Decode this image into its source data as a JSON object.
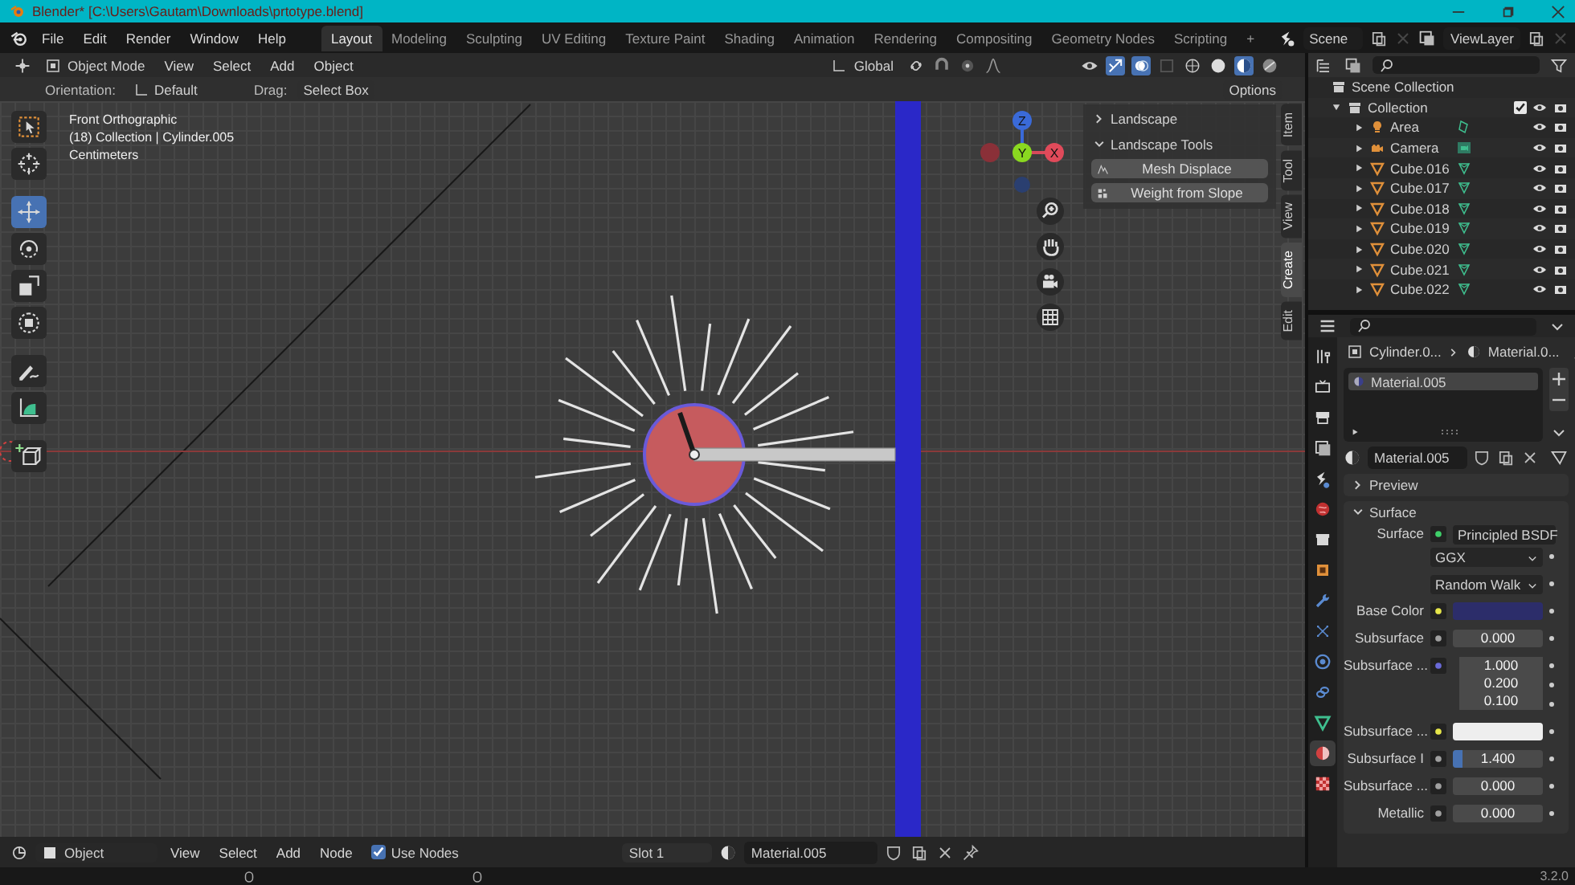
{
  "window": {
    "title": "Blender* [C:\\Users\\Gautam\\Downloads\\prtotype.blend]"
  },
  "menu": [
    "File",
    "Edit",
    "Render",
    "Window",
    "Help"
  ],
  "workspaces": [
    {
      "label": "Layout",
      "selected": true
    },
    {
      "label": "Modeling",
      "selected": false
    },
    {
      "label": "Sculpting",
      "selected": false
    },
    {
      "label": "UV Editing",
      "selected": false
    },
    {
      "label": "Texture Paint",
      "selected": false
    },
    {
      "label": "Shading",
      "selected": false
    },
    {
      "label": "Animation",
      "selected": false
    },
    {
      "label": "Rendering",
      "selected": false
    },
    {
      "label": "Compositing",
      "selected": false
    },
    {
      "label": "Geometry Nodes",
      "selected": false
    },
    {
      "label": "Scripting",
      "selected": false
    }
  ],
  "add_workspace": "+",
  "scene": "Scene",
  "view_layer": "ViewLayer",
  "viewport_header": {
    "mode": "Object Mode",
    "menus": [
      "View",
      "Select",
      "Add",
      "Object"
    ],
    "transform_orientation": "Global"
  },
  "tool_settings": {
    "orientation_label": "Orientation:",
    "orientation": "Default",
    "drag_label": "Drag:",
    "drag": "Select Box",
    "options": "Options"
  },
  "viewport_info": [
    "Front Orthographic",
    "(18) Collection | Cylinder.005",
    "Centimeters"
  ],
  "toolbar": [
    {
      "kind": "select",
      "selected": false
    },
    {
      "kind": "cursor",
      "selected": false
    },
    {
      "kind": "move",
      "selected": true
    },
    {
      "kind": "rotate",
      "selected": false
    },
    {
      "kind": "scale",
      "selected": false
    },
    {
      "kind": "transform",
      "selected": false
    },
    {
      "kind": "annotate",
      "selected": false
    },
    {
      "kind": "measure",
      "selected": false
    },
    {
      "kind": "add_cube",
      "selected": false
    }
  ],
  "gizmo_axes": [
    "Z",
    "Y",
    "X"
  ],
  "n_panel": {
    "sections": [
      {
        "label": "Landscape",
        "expanded": false
      },
      {
        "label": "Landscape Tools",
        "expanded": true
      }
    ],
    "buttons": [
      "Mesh Displace",
      "Weight from Slope"
    ]
  },
  "side_tabs": [
    {
      "label": "Item",
      "selected": false
    },
    {
      "label": "Tool",
      "selected": false
    },
    {
      "label": "View",
      "selected": false
    },
    {
      "label": "Create",
      "selected": true
    },
    {
      "label": "Edit",
      "selected": false
    }
  ],
  "outliner": {
    "root": "Scene Collection",
    "collections": [
      {
        "label": "Collection",
        "expanded": true,
        "checked": true,
        "children": [
          {
            "label": "Area",
            "kind": "light",
            "expanded": false
          },
          {
            "label": "Camera",
            "kind": "camera",
            "expanded": false
          },
          {
            "label": "Cube.016",
            "kind": "mesh",
            "expanded": false
          },
          {
            "label": "Cube.017",
            "kind": "mesh",
            "expanded": false
          },
          {
            "label": "Cube.018",
            "kind": "mesh",
            "expanded": false
          },
          {
            "label": "Cube.019",
            "kind": "mesh",
            "expanded": false
          },
          {
            "label": "Cube.020",
            "kind": "mesh",
            "expanded": false
          },
          {
            "label": "Cube.021",
            "kind": "mesh",
            "expanded": false
          },
          {
            "label": "Cube.022",
            "kind": "mesh",
            "expanded": false
          }
        ]
      }
    ]
  },
  "properties": {
    "tabs": [
      {
        "kind": "tool",
        "selected": false
      },
      {
        "kind": "render",
        "selected": false
      },
      {
        "kind": "output",
        "selected": false
      },
      {
        "kind": "view_layer",
        "selected": false
      },
      {
        "kind": "scene",
        "selected": false
      },
      {
        "kind": "world",
        "selected": false
      },
      {
        "kind": "collection",
        "selected": false
      },
      {
        "kind": "object",
        "selected": false
      },
      {
        "kind": "modifier",
        "selected": false
      },
      {
        "kind": "particles",
        "selected": false
      },
      {
        "kind": "physics",
        "selected": false
      },
      {
        "kind": "constraint",
        "selected": false
      },
      {
        "kind": "data",
        "selected": false
      },
      {
        "kind": "material",
        "selected": true
      },
      {
        "kind": "texture",
        "selected": false
      }
    ],
    "breadcrumb": [
      "Cylinder.0...",
      "Material.0..."
    ],
    "slots": [
      {
        "label": "Material.005",
        "selected": true
      }
    ],
    "material": "Material.005",
    "panels": [
      {
        "label": "Preview",
        "expanded": false
      },
      {
        "label": "Surface",
        "expanded": true
      }
    ],
    "fields": [
      {
        "kind": "shader",
        "label": "Surface",
        "value": "Principled BSDF"
      },
      {
        "kind": "dropdown",
        "value": "GGX"
      },
      {
        "kind": "dropdown",
        "value": "Random Walk"
      },
      {
        "kind": "color",
        "label": "Base Color",
        "color": "#2c2d6a"
      },
      {
        "kind": "number",
        "label": "Subsurface",
        "value": "0.000"
      },
      {
        "kind": "vector",
        "label": "Subsurface ...",
        "values": [
          "1.000",
          "0.200",
          "0.100"
        ]
      },
      {
        "kind": "color",
        "label": "Subsurface ...",
        "color": "#eeeeee"
      },
      {
        "kind": "slider",
        "label": "Subsurface I",
        "value": "1.400",
        "level": 0.1
      },
      {
        "kind": "number",
        "label": "Subsurface ...",
        "value": "0.000"
      },
      {
        "kind": "number",
        "label": "Metallic",
        "value": "0.000"
      }
    ]
  },
  "node_header": {
    "editor_type": "Object",
    "menus": [
      "View",
      "Select",
      "Add",
      "Node"
    ],
    "use_nodes": {
      "label": "Use Nodes",
      "checked": true
    },
    "slot": "Slot 1",
    "material": "Material.005"
  },
  "status_bar": {
    "version": "3.2.0"
  }
}
